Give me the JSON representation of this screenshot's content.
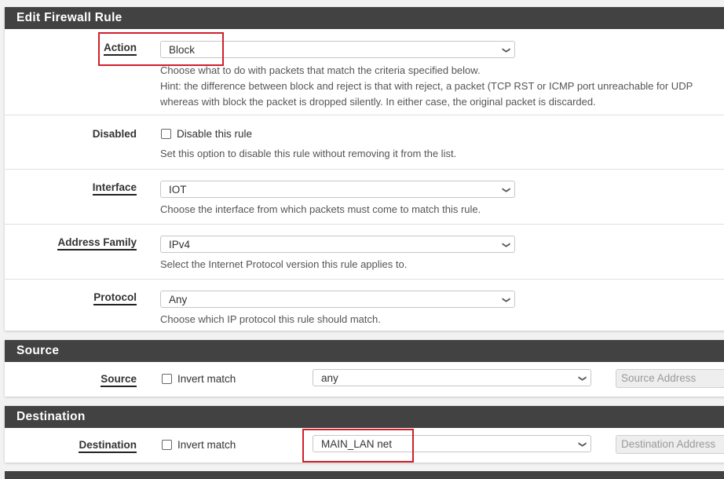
{
  "edit_rule": {
    "heading": "Edit Firewall Rule",
    "action": {
      "label": "Action",
      "value": "Block",
      "help": [
        "Choose what to do with packets that match the criteria specified below.",
        "Hint: the difference between block and reject is that with reject, a packet (TCP RST or ICMP port unreachable for UDP",
        "whereas with block the packet is dropped silently. In either case, the original packet is discarded."
      ]
    },
    "disabled": {
      "label": "Disabled",
      "checkbox_label": "Disable this rule",
      "checked": false,
      "help": "Set this option to disable this rule without removing it from the list."
    },
    "interface": {
      "label": "Interface",
      "value": "IOT",
      "help": "Choose the interface from which packets must come to match this rule."
    },
    "address_family": {
      "label": "Address Family",
      "value": "IPv4",
      "help": "Select the Internet Protocol version this rule applies to."
    },
    "protocol": {
      "label": "Protocol",
      "value": "Any",
      "help": "Choose which IP protocol this rule should match."
    }
  },
  "source": {
    "heading": "Source",
    "label": "Source",
    "invert_label": "Invert match",
    "invert_checked": false,
    "value": "any",
    "address_placeholder": "Source Address"
  },
  "destination": {
    "heading": "Destination",
    "label": "Destination",
    "invert_label": "Invert match",
    "invert_checked": false,
    "value": "MAIN_LAN net",
    "address_placeholder": "Destination Address"
  },
  "colors": {
    "heading_bg": "#424242",
    "highlight": "#d0202a"
  }
}
